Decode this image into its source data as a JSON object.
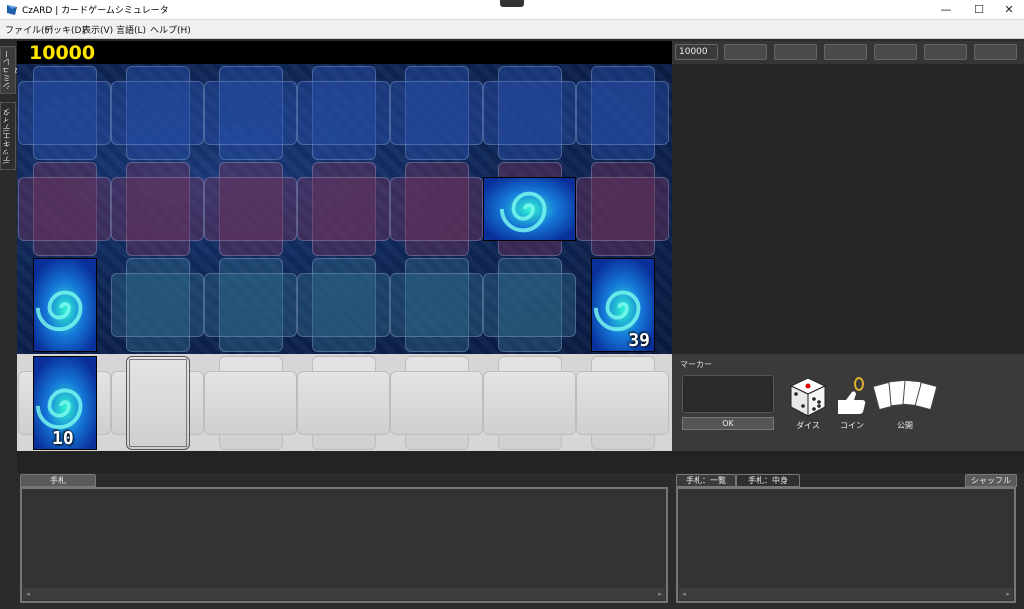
{
  "window": {
    "title": "CzARD | カードゲームシミュレータ",
    "minimize": "—",
    "maximize": "☐",
    "close": "✕"
  },
  "menu": [
    "ファイル(F)",
    "デッキ(D)",
    "表示(V)",
    "言語(L)",
    "ヘルプ(H)"
  ],
  "side_tabs": [
    "シミュレータ",
    "デッキエディタ"
  ],
  "life_points": "10000",
  "opponent_lp": "10000",
  "field": {
    "zones": {
      "deck_count": "39",
      "extra_count": "10"
    }
  },
  "marker": {
    "label": "マーカー",
    "ok_label": "OK"
  },
  "tools": {
    "dice": "ダイス",
    "coin": "コイン",
    "reveal": "公開"
  },
  "hand_panel": {
    "tab": "手札"
  },
  "right_panel": {
    "tab_list": "手札：一覧",
    "tab_content": "手札：中身",
    "shuffle": "シャッフル"
  },
  "colors": {
    "lp": "#ffe400",
    "field": "#0f2656",
    "card_swirl": "#19e0c8"
  }
}
